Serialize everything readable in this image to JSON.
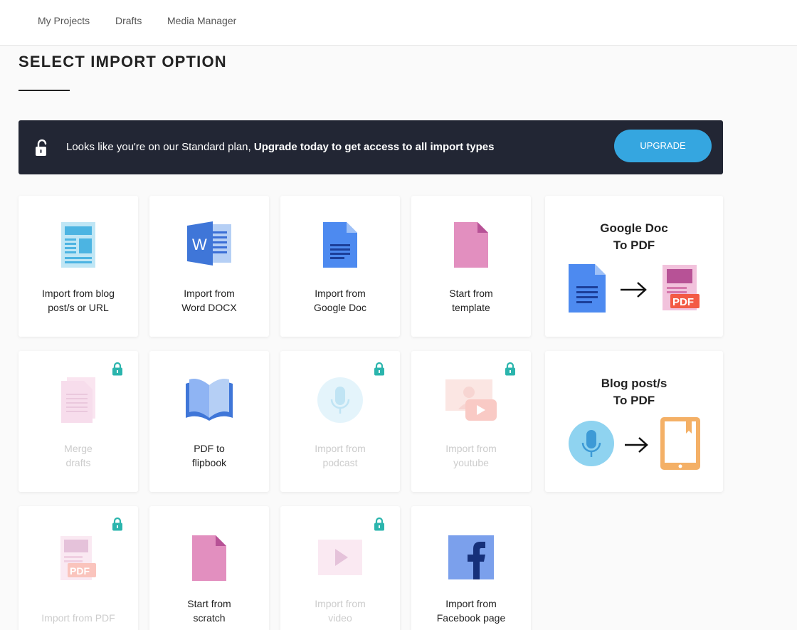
{
  "nav": {
    "my_projects": "My Projects",
    "drafts": "Drafts",
    "media_manager": "Media Manager"
  },
  "page": {
    "title": "SELECT IMPORT OPTION"
  },
  "banner": {
    "text_plain": "Looks like you're on our Standard plan, ",
    "text_bold": "Upgrade today to get access to all import types",
    "button_label": "UPGRADE"
  },
  "cards": [
    {
      "line1": "Import from blog",
      "line2": "post/s or URL",
      "locked": false,
      "icon": "blog-document-icon"
    },
    {
      "line1": "Import from",
      "line2": "Word DOCX",
      "locked": false,
      "icon": "word-docx-icon"
    },
    {
      "line1": "Import from",
      "line2": "Google Doc",
      "locked": false,
      "icon": "google-doc-icon"
    },
    {
      "line1": "Start from",
      "line2": "template",
      "locked": false,
      "icon": "template-icon"
    },
    {
      "line1": "Merge",
      "line2": "drafts",
      "locked": true,
      "icon": "merge-drafts-icon"
    },
    {
      "line1": "PDF to",
      "line2": "flipbook",
      "locked": false,
      "icon": "open-book-icon"
    },
    {
      "line1": "Import from",
      "line2": "podcast",
      "locked": true,
      "icon": "microphone-icon"
    },
    {
      "line1": "Import from",
      "line2": "youtube",
      "locked": true,
      "icon": "youtube-video-icon"
    },
    {
      "line1": "Import from PDF",
      "line2": "",
      "locked": true,
      "icon": "pdf-file-icon"
    },
    {
      "line1": "Start from",
      "line2": "scratch",
      "locked": false,
      "icon": "blank-page-icon"
    },
    {
      "line1": "Import from",
      "line2": "video",
      "locked": true,
      "icon": "video-play-icon"
    },
    {
      "line1": "Import from",
      "line2": "Facebook page",
      "locked": false,
      "icon": "facebook-icon"
    }
  ],
  "wide_cards": [
    {
      "line1": "Google Doc",
      "line2": "To PDF"
    },
    {
      "line1": "Blog post/s",
      "line2": "To PDF"
    }
  ],
  "colors": {
    "banner_bg": "#222634",
    "upgrade_button": "#35a6e0",
    "lock_icon": "#2bb5ad"
  }
}
